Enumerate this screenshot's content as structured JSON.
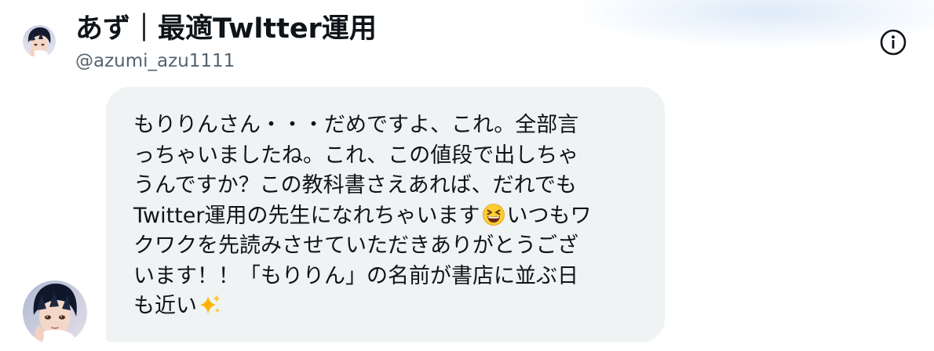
{
  "profile": {
    "display_name": "あず｜最適Twltter運用",
    "handle": "@azumi_azu1111",
    "avatar_icon": "avatar-photo"
  },
  "header": {
    "info_icon": "info-icon"
  },
  "message": {
    "lines": [
      "もりりんさん・・・だめですよ、これ。全部言",
      "っちゃいましたね。これ、この値段で出しちゃ",
      "うんですか？この教科書さえあれば、だれでも",
      "Twitter運用の先生になれちゃいます",
      "いつもワ",
      "クワクを先読みさせていただきありがとうござ",
      "います！！「もりりん」の名前が書店に並ぶ日",
      "も近い"
    ],
    "emoji_grin": "grinning-squinting-face-emoji",
    "emoji_sparkles": "sparkles-emoji"
  },
  "colors": {
    "bubble_bg": "#eff3f4",
    "text": "#0f1419",
    "secondary_text": "#536471"
  }
}
